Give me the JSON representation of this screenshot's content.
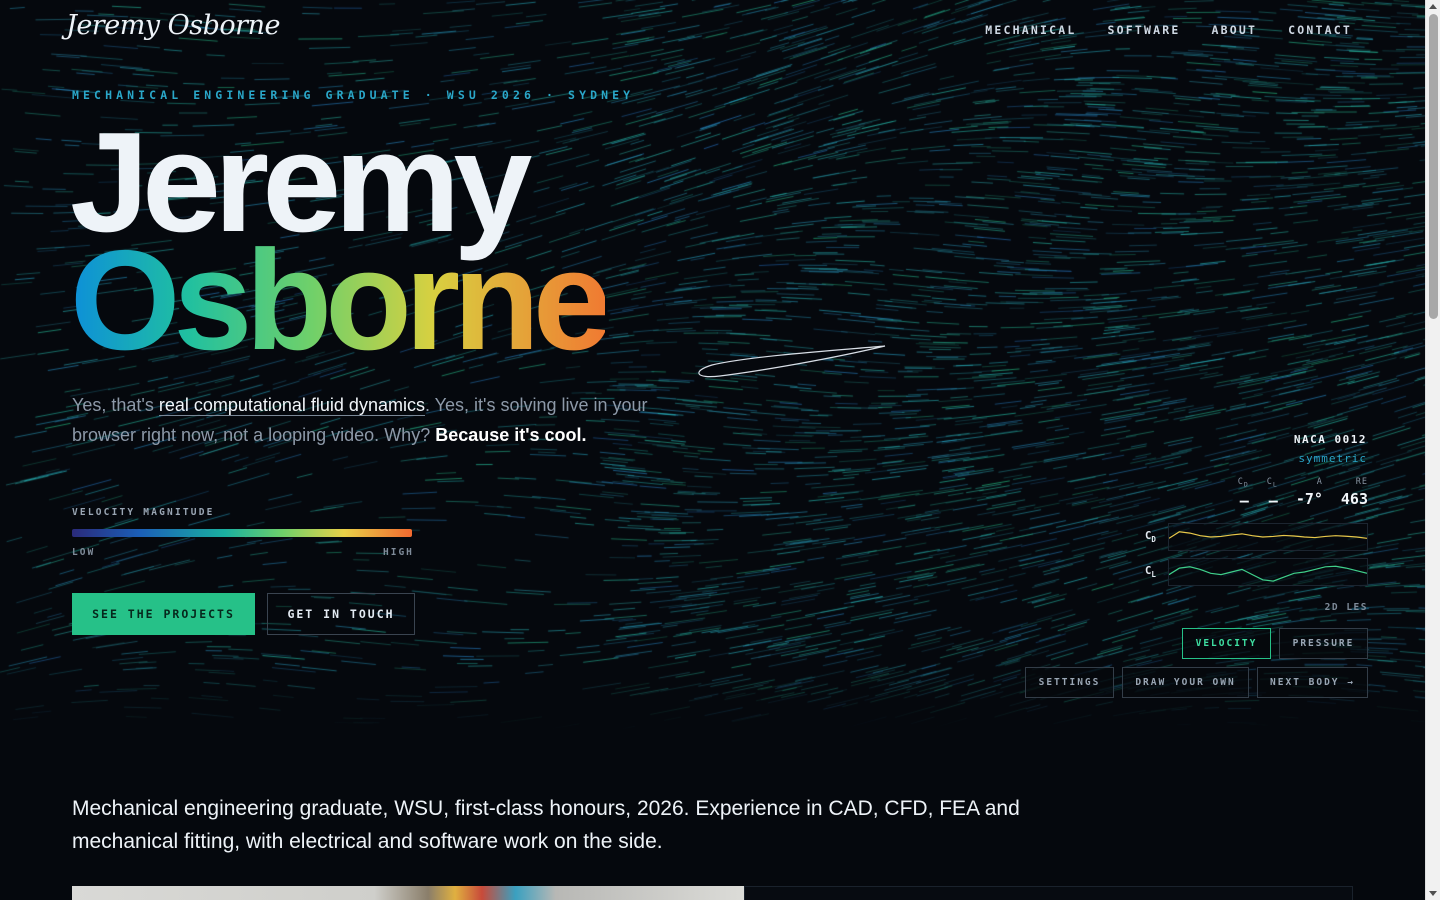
{
  "brand": "Jeremy Osborne",
  "nav": [
    "MECHANICAL",
    "SOFTWARE",
    "ABOUT",
    "CONTACT"
  ],
  "hero": {
    "eyebrow": "MECHANICAL ENGINEERING GRADUATE · WSU 2026 · SYDNEY",
    "first_name": "Jeremy",
    "last_name": "Osborne",
    "tagline": {
      "p1": "Yes, that's ",
      "p2": "real computational fluid dynamics",
      "p3": ". Yes, it's solving live in your browser right now, not a looping video. Why? ",
      "p4": "Because it's cool."
    }
  },
  "velocity_legend": {
    "title": "VELOCITY MAGNITUDE",
    "low": "LOW",
    "high": "HIGH"
  },
  "cta": {
    "primary": "SEE THE PROJECTS",
    "secondary": "GET IN TOUCH"
  },
  "sim": {
    "body_name": "NACA 0012",
    "body_type": "symmetric",
    "stats": [
      {
        "key": "C",
        "sub": "D",
        "value": "–"
      },
      {
        "key": "C",
        "sub": "L",
        "value": "–"
      },
      {
        "key": "A",
        "sub": "",
        "value": "-7°"
      },
      {
        "key": "RE",
        "sub": "",
        "value": "463"
      }
    ],
    "cd_label": "C",
    "cd_sub": "D",
    "cl_label": "C",
    "cl_sub": "L",
    "cd_history": [
      0.55,
      0.3,
      0.35,
      0.45,
      0.5,
      0.48,
      0.42,
      0.38,
      0.45,
      0.5,
      0.48,
      0.44,
      0.46,
      0.5,
      0.52,
      0.48,
      0.45,
      0.47,
      0.5,
      0.55
    ],
    "cl_history": [
      0.6,
      0.35,
      0.3,
      0.4,
      0.55,
      0.6,
      0.5,
      0.4,
      0.6,
      0.8,
      0.85,
      0.7,
      0.55,
      0.5,
      0.4,
      0.3,
      0.28,
      0.35,
      0.45,
      0.55
    ],
    "cd_color": "#e8c84a",
    "cl_color": "#3fce8a",
    "solver": "2D LES",
    "modes": [
      "VELOCITY",
      "PRESSURE"
    ],
    "active_mode": "VELOCITY",
    "actions": [
      "SETTINGS",
      "DRAW YOUR OWN",
      "NEXT BODY →"
    ]
  },
  "intro": "Mechanical engineering graduate, WSU, first-class honours, 2026. Experience in CAD, CFD, FEA and mechanical fitting, with electrical and software work on the side."
}
